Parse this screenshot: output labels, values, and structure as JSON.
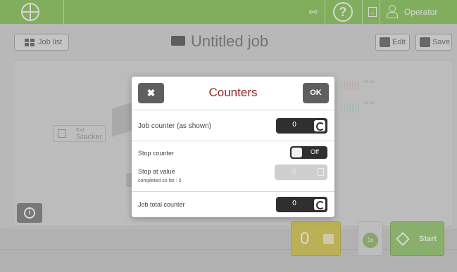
{
  "topbar": {
    "user_label": "Operator",
    "help_glyph": "?",
    "accent_color": "#7bc043"
  },
  "titlebar": {
    "joblist_label": "Job list",
    "job_title": "Untitled job",
    "edit_label": "Edit",
    "save_label": "Save"
  },
  "workspace": {
    "exit_label_small": "Exit:",
    "exit_label": "Stacker",
    "doc_a_label": "A4 1x",
    "doc_b_label": "A4 1x"
  },
  "bottom": {
    "counter_value": "0",
    "cycles_label": "1x",
    "start_label": "Start",
    "start_color": "#86c25a",
    "counter_color": "#d4c43a"
  },
  "dialog": {
    "title": "Counters",
    "ok_label": "OK",
    "close_glyph": "✖",
    "job_counter_label": "Job counter (as shown)",
    "job_counter_value": "0",
    "stop_counter_label": "Stop counter",
    "stop_counter_state": "Off",
    "stop_at_label": "Stop at value",
    "completed_label": "completed so far : 0",
    "stop_at_value": "0",
    "job_total_label": "Job total counter",
    "job_total_value": "0"
  }
}
